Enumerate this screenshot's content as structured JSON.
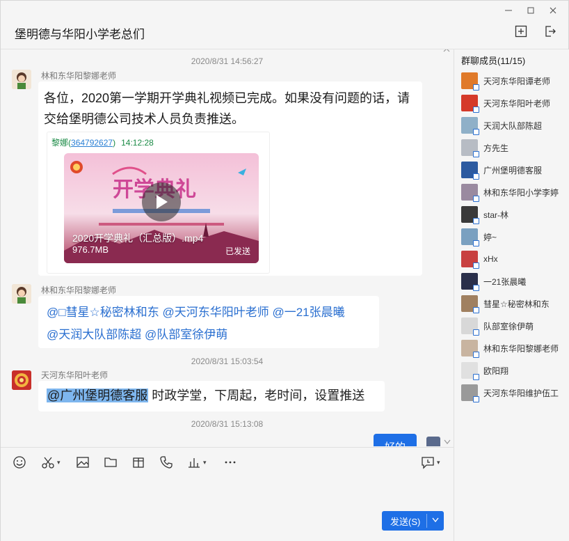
{
  "window": {
    "title": "堡明德与华阳小学老总们"
  },
  "messages": [
    {
      "timestamp": "2020/8/31 14:56:27",
      "sender": "林和东华阳黎娜老师",
      "text": "各位，2020第一学期开学典礼视频已完成。如果没有问题的话，请交给堡明德公司技术人员负责推送。",
      "quote": {
        "author": "黎娜",
        "qq": "364792627",
        "time": "14:12:28",
        "file_name": "2020开学典礼（汇总版）.mp4",
        "file_size": "976.7MB",
        "status": "已发送"
      }
    },
    {
      "sender": "林和东华阳黎娜老师",
      "line1": "@□彗星☆秘密林和东 @天河东华阳叶老师 @一21张晨曦",
      "line2": "@天润大队部陈超 @队部室徐伊萌"
    },
    {
      "timestamp": "2020/8/31 15:03:54",
      "sender": "天河东华阳叶老师",
      "mention": "@广州堡明德客服",
      "text": " 时政学堂，下周起，老时间，设置推送"
    },
    {
      "timestamp": "2020/8/31 15:13:08",
      "reply": "好的"
    }
  ],
  "input": {
    "send_label": "发送(S)"
  },
  "members": {
    "title": "群聊成员(11/15)",
    "list": [
      {
        "name": "天河东华阳谭老师",
        "color": "#e07a2a"
      },
      {
        "name": "天河东华阳叶老师",
        "color": "#d53a2a"
      },
      {
        "name": "天润大队部陈超",
        "color": "#8fb0c8"
      },
      {
        "name": "方先生",
        "color": "#b7bcc4"
      },
      {
        "name": "广州堡明德客服",
        "color": "#2c5aa0"
      },
      {
        "name": "林和东华阳小学李婷",
        "color": "#9a8aa0"
      },
      {
        "name": "star-林",
        "color": "#3a3a3a"
      },
      {
        "name": "婷~",
        "color": "#7aa0c0"
      },
      {
        "name": "xHx",
        "color": "#c84040"
      },
      {
        "name": "一21张晨曦",
        "color": "#2a2f4a"
      },
      {
        "name": "彗星☆秘密林和东",
        "color": "#a08060"
      },
      {
        "name": "队部室徐伊萌",
        "color": "#d8d8d8"
      },
      {
        "name": "林和东华阳黎娜老师",
        "color": "#c8b4a0"
      },
      {
        "name": "欧阳翔",
        "color": "#e0e0e0"
      },
      {
        "name": "天河东华阳维护伍工",
        "color": "#9a9a9a"
      }
    ]
  }
}
